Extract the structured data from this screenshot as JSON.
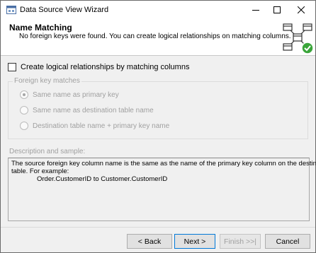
{
  "window": {
    "title": "Data Source View Wizard"
  },
  "header": {
    "title": "Name Matching",
    "subtitle": "No foreign keys were found. You can create logical relationships on matching columns."
  },
  "create_relationships": {
    "label": "Create logical relationships by matching columns",
    "checked": false
  },
  "foreign_key_matches": {
    "legend": "Foreign key matches",
    "options": [
      {
        "label": "Same name as primary key",
        "selected": true
      },
      {
        "label": "Same name as destination table name",
        "selected": false
      },
      {
        "label": "Destination table name + primary key name",
        "selected": false
      }
    ]
  },
  "description": {
    "label": "Description and sample:",
    "lines": [
      "The source foreign key column name is the same as the name of the primary key column on the destination",
      "table. For example:",
      "Order.CustomerID to Customer.CustomerID"
    ]
  },
  "buttons": {
    "back": "< Back",
    "next": "Next >",
    "finish": "Finish >>|",
    "cancel": "Cancel"
  },
  "colors": {
    "accent": "#0078d7",
    "check_badge": "#3aa53a",
    "disabled_text": "#a0a0a0"
  },
  "icons": {
    "app": "wizard-icon",
    "header": "data-source-view-graph-icon"
  }
}
